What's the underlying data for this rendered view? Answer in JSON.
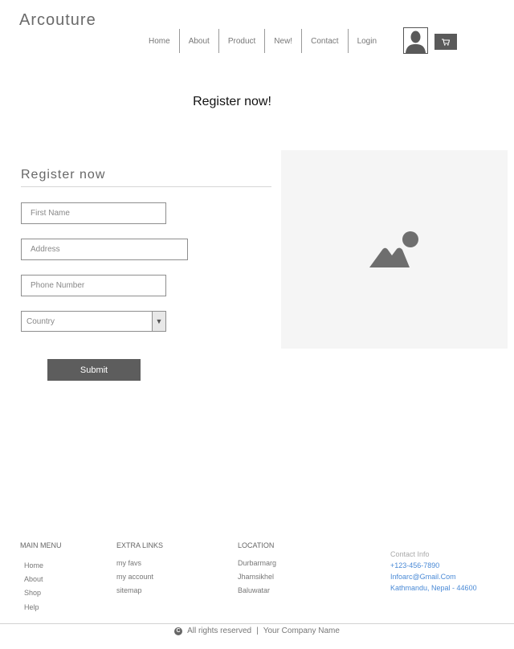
{
  "header": {
    "brand": "Arcouture",
    "nav": [
      "Home",
      "About",
      "Product",
      "New!",
      "Contact",
      "Login"
    ]
  },
  "hero": {
    "title": "Register now!"
  },
  "form": {
    "title": "Register now",
    "first_name_placeholder": "First Name",
    "address_placeholder": "Address",
    "phone_placeholder": "Phone Number",
    "country_value": "Country",
    "submit_label": "Submit"
  },
  "footer": {
    "main_menu": {
      "heading": "MAIN MENU",
      "items": [
        "Home",
        "About",
        "Shop",
        "Help"
      ]
    },
    "extra_links": {
      "heading": "EXTRA LINKS",
      "items": [
        "my favs",
        "my account",
        "sitemap"
      ]
    },
    "location": {
      "heading": "LOCATION",
      "items": [
        "Durbarmarg",
        "Jhamsikhel",
        "Baluwatar"
      ]
    },
    "contact": {
      "label": "Contact Info",
      "phone": "+123-456-7890",
      "email": "Infoarc@Gmail.Com",
      "address": "Kathmandu, Nepal - 44600"
    },
    "copyright": "All rights reserved",
    "separator": "|",
    "company": "Your Company Name"
  },
  "colors": {
    "accent": "#5d5d5d",
    "link": "#4a8ad6",
    "placeholder_bg": "#f5f5f5"
  }
}
